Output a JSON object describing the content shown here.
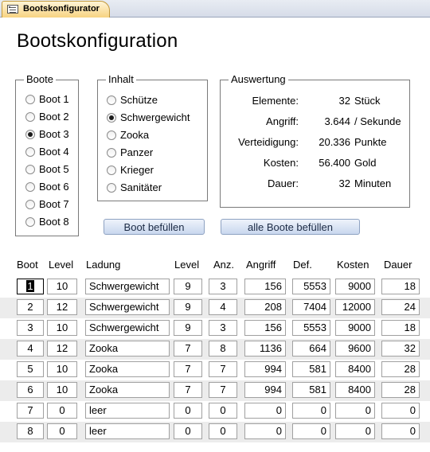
{
  "window": {
    "tab_title": "Bootskonfigurator"
  },
  "title": "Bootskonfiguration",
  "boote": {
    "legend": "Boote",
    "options": [
      "Boot 1",
      "Boot 2",
      "Boot 3",
      "Boot 4",
      "Boot 5",
      "Boot 6",
      "Boot 7",
      "Boot 8"
    ],
    "selected_index": 2
  },
  "inhalt": {
    "legend": "Inhalt",
    "options": [
      "Schütze",
      "Schwergewicht",
      "Zooka",
      "Panzer",
      "Krieger",
      "Sanitäter"
    ],
    "selected_index": 1
  },
  "auswertung": {
    "legend": "Auswertung",
    "rows": [
      {
        "label": "Elemente:",
        "value": "32",
        "unit": "Stück"
      },
      {
        "label": "Angriff:",
        "value": "3.644",
        "unit": "/ Sekunde"
      },
      {
        "label": "Verteidigung:",
        "value": "20.336",
        "unit": "Punkte"
      },
      {
        "label": "Kosten:",
        "value": "56.400",
        "unit": "Gold"
      },
      {
        "label": "Dauer:",
        "value": "32",
        "unit": "Minuten"
      }
    ]
  },
  "buttons": {
    "fill_one": "Boot befüllen",
    "fill_all": "alle Boote befüllen"
  },
  "table": {
    "headers": [
      "Boot",
      "Level",
      "Ladung",
      "Level",
      "Anz.",
      "Angriff",
      "Def.",
      "Kosten",
      "Dauer"
    ],
    "rows": [
      [
        "1",
        "10",
        "Schwergewicht",
        "9",
        "3",
        "156",
        "5553",
        "9000",
        "18"
      ],
      [
        "2",
        "12",
        "Schwergewicht",
        "9",
        "4",
        "208",
        "7404",
        "12000",
        "24"
      ],
      [
        "3",
        "10",
        "Schwergewicht",
        "9",
        "3",
        "156",
        "5553",
        "9000",
        "18"
      ],
      [
        "4",
        "12",
        "Zooka",
        "7",
        "8",
        "1136",
        "664",
        "9600",
        "32"
      ],
      [
        "5",
        "10",
        "Zooka",
        "7",
        "7",
        "994",
        "581",
        "8400",
        "28"
      ],
      [
        "6",
        "10",
        "Zooka",
        "7",
        "7",
        "994",
        "581",
        "8400",
        "28"
      ],
      [
        "7",
        "0",
        "leer",
        "0",
        "0",
        "0",
        "0",
        "0",
        "0"
      ],
      [
        "8",
        "0",
        "leer",
        "0",
        "0",
        "0",
        "0",
        "0",
        "0"
      ]
    ]
  }
}
